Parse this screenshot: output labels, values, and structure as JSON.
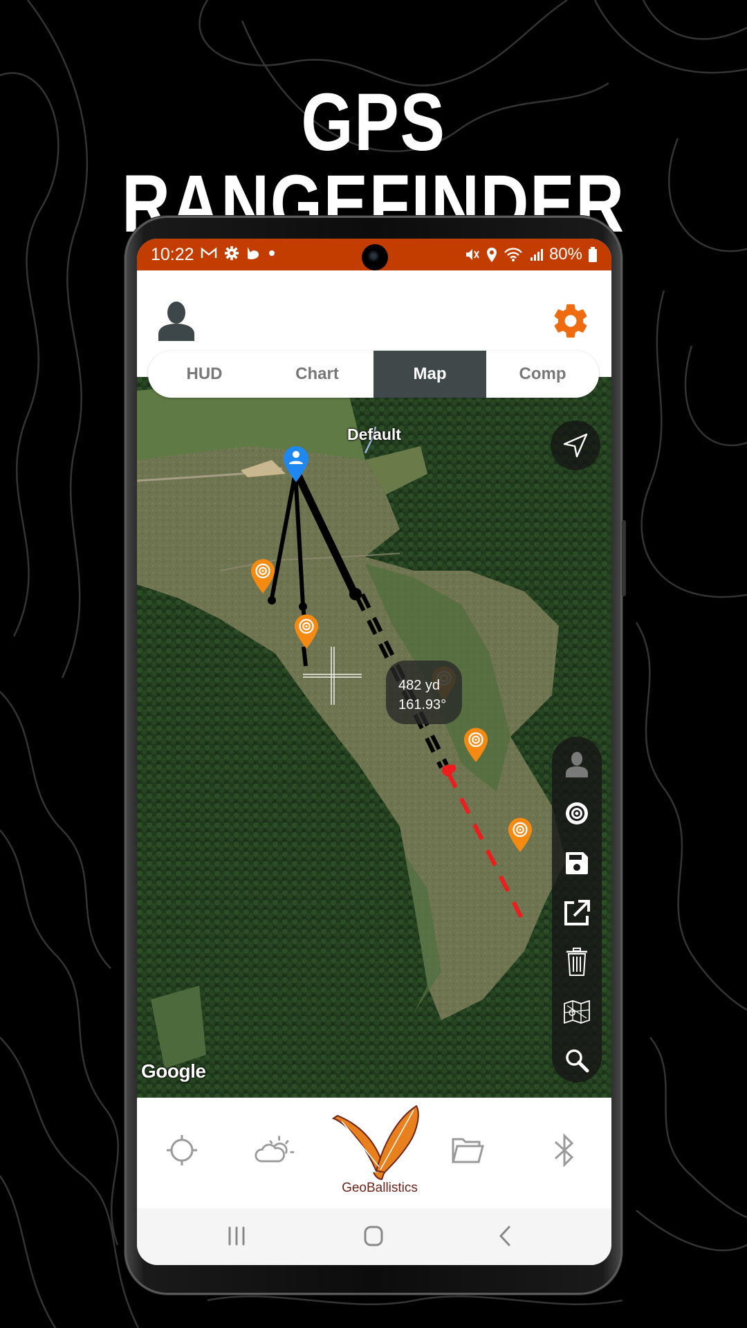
{
  "promo": {
    "headline": "GPS RANGEFINDER"
  },
  "status_bar": {
    "time": "10:22",
    "left_icons": [
      "gmail-icon",
      "settings-icon",
      "bixby-icon",
      "dot-icon"
    ],
    "right_icons": [
      "mute-icon",
      "location-icon",
      "wifi-icon",
      "signal-icon"
    ],
    "battery": "80%",
    "color": "#C43D00"
  },
  "header": {
    "profile_icon": "user-icon",
    "settings_icon": "gear-icon",
    "accent_color": "#EE6B10"
  },
  "tabs": [
    {
      "label": "HUD",
      "active": false
    },
    {
      "label": "Chart",
      "active": false
    },
    {
      "label": "Map",
      "active": true
    },
    {
      "label": "Comp",
      "active": false
    }
  ],
  "map": {
    "profile_label": "Default",
    "attribution": "Google",
    "measurement": {
      "distance": "482 yd",
      "bearing": "161.93°"
    },
    "markers": {
      "shooter": "user-location-pin",
      "targets": 5
    },
    "locate_icon": "navigation-arrow-icon",
    "toolbar": [
      {
        "name": "shooter-tool",
        "icon": "person-icon"
      },
      {
        "name": "target-tool",
        "icon": "target-icon"
      },
      {
        "name": "save-tool",
        "icon": "save-icon"
      },
      {
        "name": "share-tool",
        "icon": "open-external-icon"
      },
      {
        "name": "delete-tool",
        "icon": "trash-icon"
      },
      {
        "name": "map-layers-tool",
        "icon": "map-icon"
      },
      {
        "name": "search-tool",
        "icon": "search-icon"
      }
    ]
  },
  "bottom_nav": {
    "items": [
      {
        "name": "rangefinder",
        "icon": "crosshair-icon"
      },
      {
        "name": "weather",
        "icon": "weather-icon"
      },
      {
        "name": "home",
        "icon": "geoballistics-logo"
      },
      {
        "name": "files",
        "icon": "folder-icon"
      },
      {
        "name": "bluetooth",
        "icon": "bluetooth-icon"
      }
    ],
    "logo_text": "GeoBallistics",
    "logo_color": "#E8801E"
  },
  "system_nav": {
    "buttons": [
      "recents",
      "home",
      "back"
    ]
  }
}
